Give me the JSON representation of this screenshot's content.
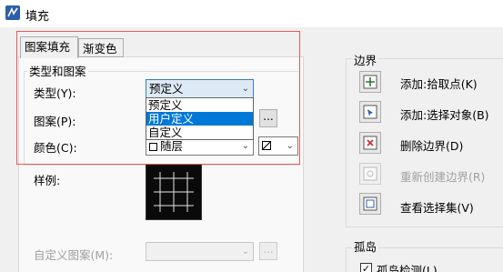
{
  "window": {
    "title": "填充"
  },
  "tabs": [
    "图案填充",
    "渐变色"
  ],
  "group": {
    "title": "类型和图案"
  },
  "type_row": {
    "label": "类型(Y):",
    "value": "预定义"
  },
  "dropdown_options": [
    "预定义",
    "用户定义",
    "自定义"
  ],
  "dropdown_selected": "用户定义",
  "pattern_row": {
    "label": "图案(P):",
    "browse": "..."
  },
  "color_row": {
    "label": "颜色(C):",
    "value": "随层"
  },
  "sample_row": {
    "label": "样例:"
  },
  "custom_pattern_row": {
    "label": "自定义图案(M):",
    "browse": "..."
  },
  "boundary": {
    "title": "边界",
    "items": [
      {
        "label": "添加:拾取点(K)",
        "icon": "pick-point-icon",
        "enabled": true
      },
      {
        "label": "添加:选择对象(B)",
        "icon": "select-objects-icon",
        "enabled": true
      },
      {
        "label": "删除边界(D)",
        "icon": "remove-boundary-icon",
        "enabled": true
      },
      {
        "label": "重新创建边界(R)",
        "icon": "recreate-boundary-icon",
        "enabled": false
      },
      {
        "label": "查看选择集(V)",
        "icon": "view-selection-icon",
        "enabled": true
      }
    ]
  },
  "islands": {
    "title": "孤岛",
    "detect_label": "孤岛检测(L)",
    "checked": true
  },
  "colors": {
    "selection": "#0078d7",
    "highlight": "#e65a5a"
  }
}
